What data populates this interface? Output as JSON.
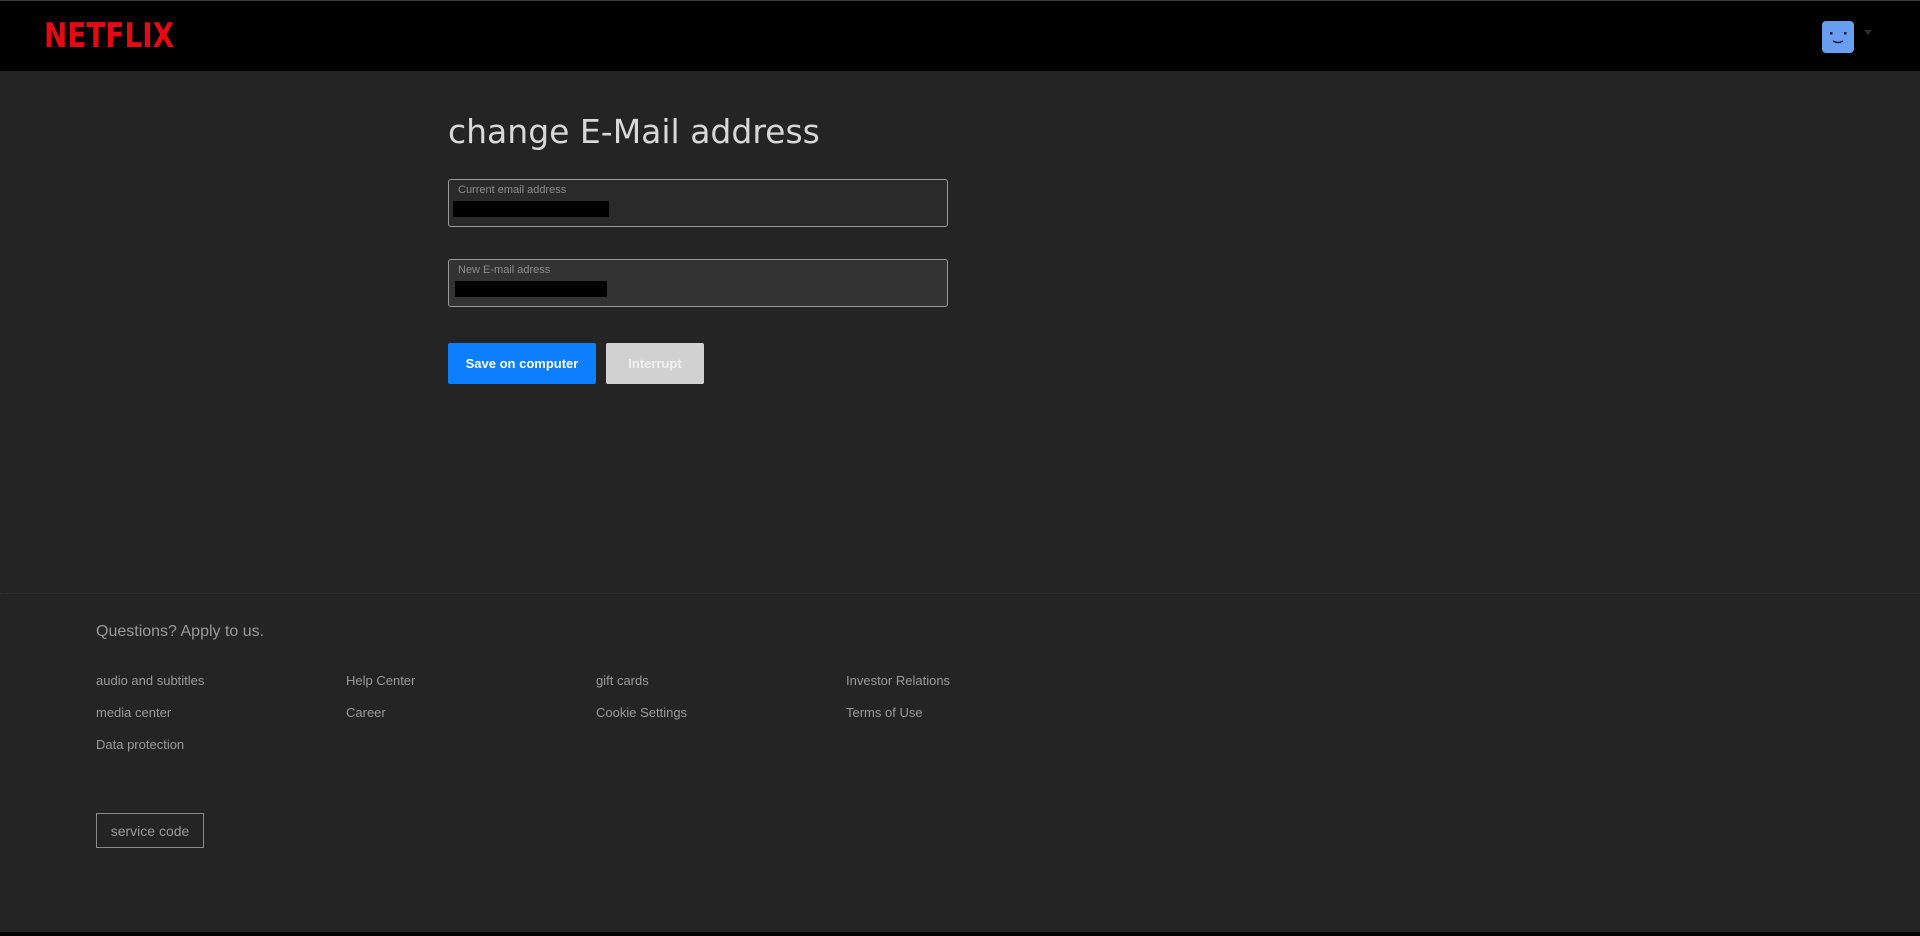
{
  "header": {
    "logo_text": "NETFLIX",
    "logo_color": "#e50914",
    "profile_avatar_color": "#6a9ef0",
    "profile_icon": "smiley-avatar-icon",
    "menu_icon": "caret-down-icon"
  },
  "main": {
    "title": "change E-Mail address",
    "current_email": {
      "label": "Current email address",
      "value": ""
    },
    "new_email": {
      "label": "New E-mail adress",
      "value": ""
    },
    "save_label": "Save on computer",
    "save_color": "#0c7fff",
    "interrupt_label": "Interrupt"
  },
  "footer": {
    "question": "Questions? Apply to us.",
    "links": [
      "audio and subtitles",
      "media center",
      "Data protection",
      "Help Center",
      "Career",
      "gift cards",
      "Cookie Settings",
      "Investor Relations",
      "Terms of Use"
    ],
    "service_code_label": "service code"
  }
}
